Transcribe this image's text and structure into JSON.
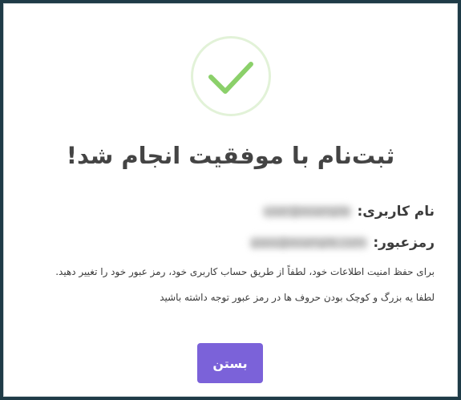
{
  "dialog": {
    "title": "ثبت‌نام با موفقیت انجام شد!",
    "username_label": "نام کاربری:",
    "username_value": "user@example",
    "password_label": "رمزعبور:",
    "password_value": "pass@example.com",
    "note_line1": "برای حفظ امنیت اطلاعات خود، لطفاً از طریق حساب کاربری خود، رمز عبور خود را تغییر دهید.",
    "note_line2": "لطفا یه بزرگ و کوچک بودن حروف ها در رمز عبور توجه داشته باشید",
    "close_label": "بستن"
  },
  "icons": {
    "success": "check-icon"
  },
  "colors": {
    "accent": "#7b62d9",
    "success": "#8bd06a",
    "success_ring": "#e2f2d8"
  }
}
